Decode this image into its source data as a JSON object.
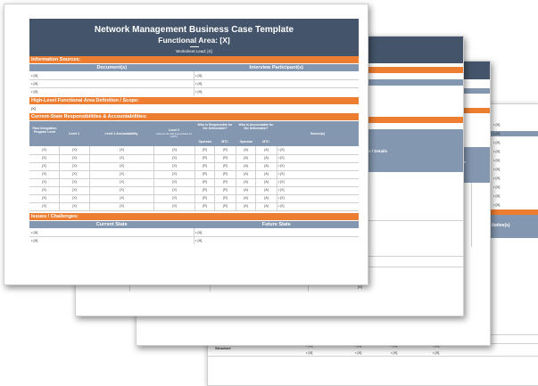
{
  "main": {
    "title": "Network Management Business Case Template",
    "subtitle": "Functional Area: [X]",
    "lead": "Worksheet Lead: [X]",
    "sections": {
      "info_sources": "Information Sources:",
      "documents": "Document(s)",
      "interviews": "Interview Participant(s)",
      "scope": "High-Level Functional Area Definition / Scope:",
      "scope_value": "[X]",
      "responsibilities": "Current-State Responsibilities & Accountabilities:",
      "issues": "Issues / Challenges:",
      "current_state": "Current State",
      "future_state": "Future State"
    },
    "bullet": "• [X]",
    "placeholder": "[X]",
    "table_headers": {
      "face": "Face Integration Program Level",
      "level1": "Level 1",
      "level1_acc": "Level 1 Accountability",
      "level2": "Level 2",
      "level2_note": "(what are the high level activities for each?)",
      "responsible": "Who is Responsible for the Deliverable?",
      "accountable": "Who is Accountable for the Deliverable?",
      "operator": "Operator",
      "mtc": "MTC",
      "sources": "Source(s)"
    },
    "rows": [
      [
        "[X]",
        "[X]",
        "[X]",
        "[X]",
        "[R]",
        "[R]",
        "[A]",
        "[A]",
        "• [X]"
      ],
      [
        "[X]",
        "[X]",
        "[X]",
        "[X]",
        "[R]",
        "[R]",
        "[A]",
        "[A]",
        "• [X]"
      ],
      [
        "[X]",
        "[X]",
        "[X]",
        "[X]",
        "[R]",
        "[R]",
        "[A]",
        "[A]",
        "• [X]"
      ],
      [
        "[X]",
        "[X]",
        "[X]",
        "[X]",
        "[R]",
        "[R]",
        "[A]",
        "[A]",
        "• [X]"
      ],
      [
        "[X]",
        "[X]",
        "[X]",
        "[X]",
        "[R]",
        "[R]",
        "[A]",
        "[A]",
        "• [X]"
      ],
      [
        "[X]",
        "[X]",
        "[X]",
        "[X]",
        "[R]",
        "[R]",
        "[A]",
        "[A]",
        "• [X]"
      ],
      [
        "[X]",
        "[X]",
        "[X]",
        "[X]",
        "[R]",
        "[R]",
        "[A]",
        "[A]",
        "• [X]"
      ],
      [
        "[X]",
        "[X]",
        "[X]",
        "[X]",
        "[R]",
        "[R]",
        "[A]",
        "[A]",
        "• [X]"
      ]
    ]
  },
  "back": {
    "notes_details": "Notes / Details",
    "behaviors_culture": "Behaviors & Culture",
    "check": "[✓]",
    "itative": "itative(s)",
    "structure": "Structure",
    "placeholder": "[X]",
    "bullet": "• [X]"
  },
  "colors": {
    "header": "#44546a",
    "orange": "#ed7d31",
    "steel": "#8497b0"
  }
}
